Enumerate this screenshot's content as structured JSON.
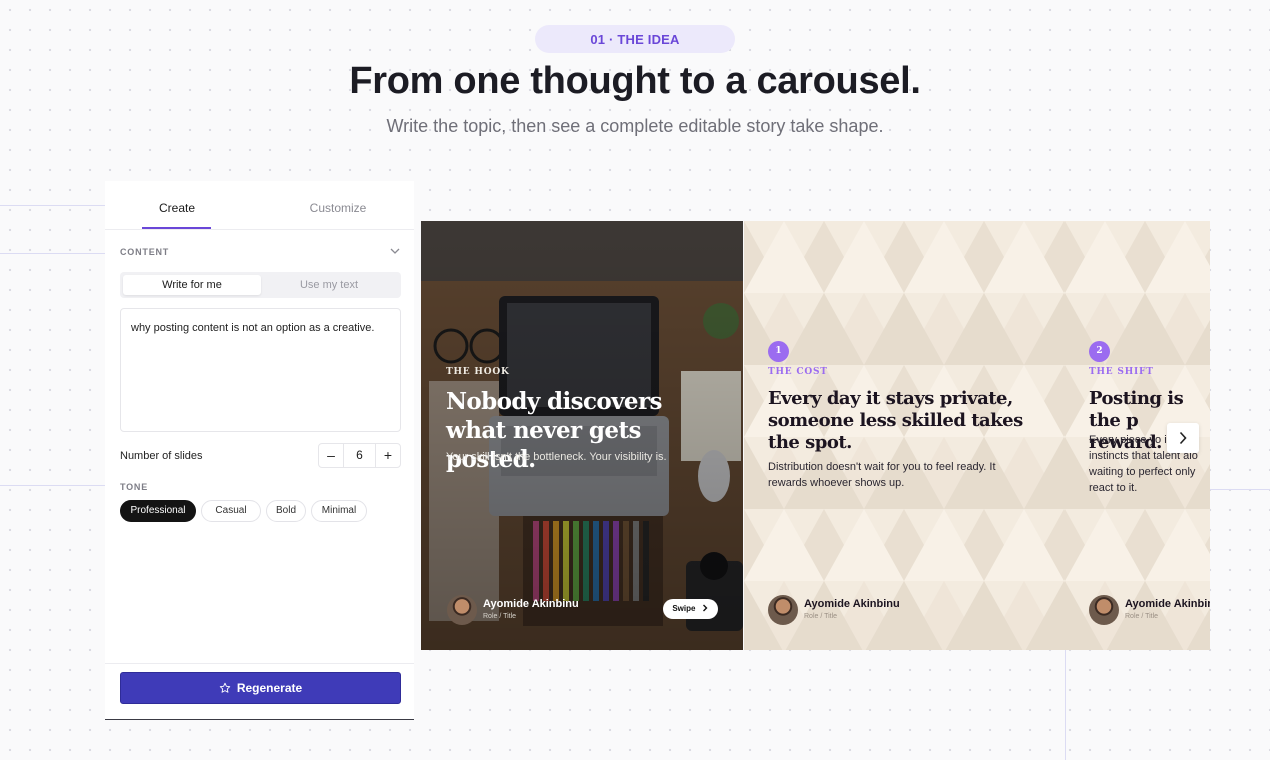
{
  "header": {
    "eyebrow": "01 · THE IDEA",
    "title": "From one thought to a carousel.",
    "subtitle": "Write the topic, then see a complete editable story take shape."
  },
  "panel": {
    "tabs": [
      {
        "label": "Create",
        "active": true
      },
      {
        "label": "Customize",
        "active": false
      }
    ],
    "content_label": "CONTENT",
    "mode_options": [
      {
        "label": "Write for me",
        "selected": true
      },
      {
        "label": "Use my text",
        "selected": false
      }
    ],
    "topic_value": "why posting content is not an option as a creative.",
    "slides_label": "Number of slides",
    "slides_count": "6",
    "minus_symbol": "–",
    "plus_symbol": "+",
    "tone_label": "TONE",
    "tones": [
      {
        "label": "Professional",
        "selected": true
      },
      {
        "label": "Casual",
        "selected": false
      },
      {
        "label": "Bold",
        "selected": false
      },
      {
        "label": "Minimal",
        "selected": false
      }
    ],
    "regenerate_label": "Regenerate"
  },
  "slides": [
    {
      "kicker": "THE HOOK",
      "title": "Nobody discovers what never gets posted.",
      "body": "Your skill isn't the bottleneck. Your visibility is.",
      "author_name": "Ayomide Akinbinu",
      "author_role": "Role / Title",
      "swipe_label": "Swipe"
    },
    {
      "number": "1",
      "kicker": "THE COST",
      "title": "Every day it stays private, someone less skilled takes the spot.",
      "body": "Distribution doesn't wait for you to feel ready. It rewards whoever shows up.",
      "author_name": "Ayomide Akinbinu",
      "author_role": "Role / Title"
    },
    {
      "number": "2",
      "kicker": "THE SHIFT",
      "title": "Posting is the p reward.",
      "body": "Every piece yo is instincts that talent alo waiting to perfect only react to it.",
      "author_name": "Ayomide Akinbin",
      "author_role": "Role / Title"
    }
  ],
  "colors": {
    "accent": "#6a47d8",
    "slide_accent": "#9b6cf0",
    "regenerate_bg": "#3f3bb8",
    "slide_bg": "#f3ebdf"
  },
  "icons": {
    "collapse": "chevron-down-icon",
    "regenerate": "star-icon",
    "next": "chevron-right-icon"
  }
}
